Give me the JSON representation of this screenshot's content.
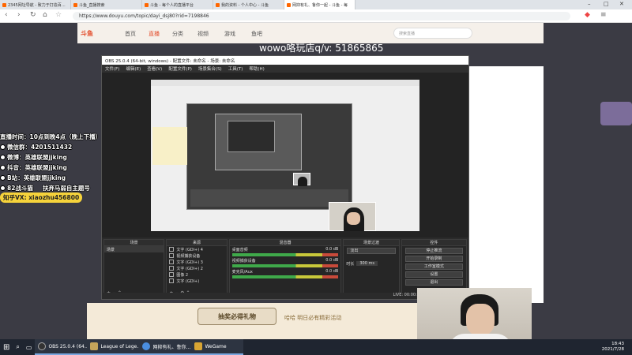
{
  "browser": {
    "tabs": [
      {
        "label": "2345网址导航 - 致力于打造百…"
      },
      {
        "label": "斗鱼_直播搜索"
      },
      {
        "label": "斗鱼 - 每个人的直播平台"
      },
      {
        "label": "我的资料 - 个人中心 - 斗鱼"
      },
      {
        "label": "网抑有礼、鲁你一起 - 斗鱼 - 每"
      }
    ],
    "url": "https://www.douyu.com/topic/dayi_dsj80?rid=7198846"
  },
  "douyu": {
    "logo": "斗鱼",
    "nav": [
      "首页",
      "直播",
      "分类",
      "视频",
      "游戏",
      "鱼吧"
    ],
    "search_placeholder": "搜索直播",
    "banner_button": "抽奖必得礼物",
    "banner_sub": "哈哈 明日必有精彩活动"
  },
  "watermark": "wowo咯玩店q/v: 51865865",
  "overlay": {
    "lines": [
      "直播时间：10点到晚4点（晚上下播）",
      "微信群：4201511432",
      "微博：英雄联盟jjking",
      "抖音：英雄联盟jjking",
      "B站：英雄联盟jjking",
      "82战斗猫",
      "扶弃马弱自主题号",
      "知乎VX: xiaozhu456800"
    ]
  },
  "obs": {
    "title": "OBS 25.0.4 (64-bit, windows) - 配置文件: 未命名 - 场景: 未命名",
    "menu": [
      "文件(F)",
      "编辑(E)",
      "查看(V)",
      "配置文件(P)",
      "场景集合(S)",
      "工具(T)",
      "帮助(H)"
    ],
    "docks": {
      "scenes_title": "场景",
      "scene_item": "场景",
      "sources_title": "来源",
      "sources": [
        "文字 (GDI+) 4",
        "视频捕获设备",
        "文字 (GDI+) 3",
        "文字 (GDI+) 2",
        "图像 2",
        "文字 (GDI+)"
      ],
      "mixer_title": "混音器",
      "mixer": [
        {
          "name": "桌面音频",
          "db": "0.0 dB"
        },
        {
          "name": "视频捕获设备",
          "db": "0.0 dB"
        },
        {
          "name": "麦克风/Aux",
          "db": "0.0 dB"
        }
      ],
      "transitions_title": "场景过渡",
      "transition_type": "淡出",
      "duration_label": "时长",
      "duration_value": "300 ms",
      "controls_title": "控件",
      "controls": [
        "停止推流",
        "开始录制",
        "工作室模式",
        "设置",
        "退出"
      ]
    },
    "status": "LIVE: 00:00:00   REC: 00:00:00   CPU:"
  },
  "taskbar": {
    "items": [
      {
        "label": "OBS 25.0.4 (64…",
        "color": "#333333"
      },
      {
        "label": "League of Lege…",
        "color": "#c4a45a"
      },
      {
        "label": "网抑有礼、鲁你…",
        "color": "#4a8ee0"
      },
      {
        "label": "WeGame",
        "color": "#d8a533"
      }
    ],
    "time": "18:43",
    "date": "2021/7/28"
  }
}
